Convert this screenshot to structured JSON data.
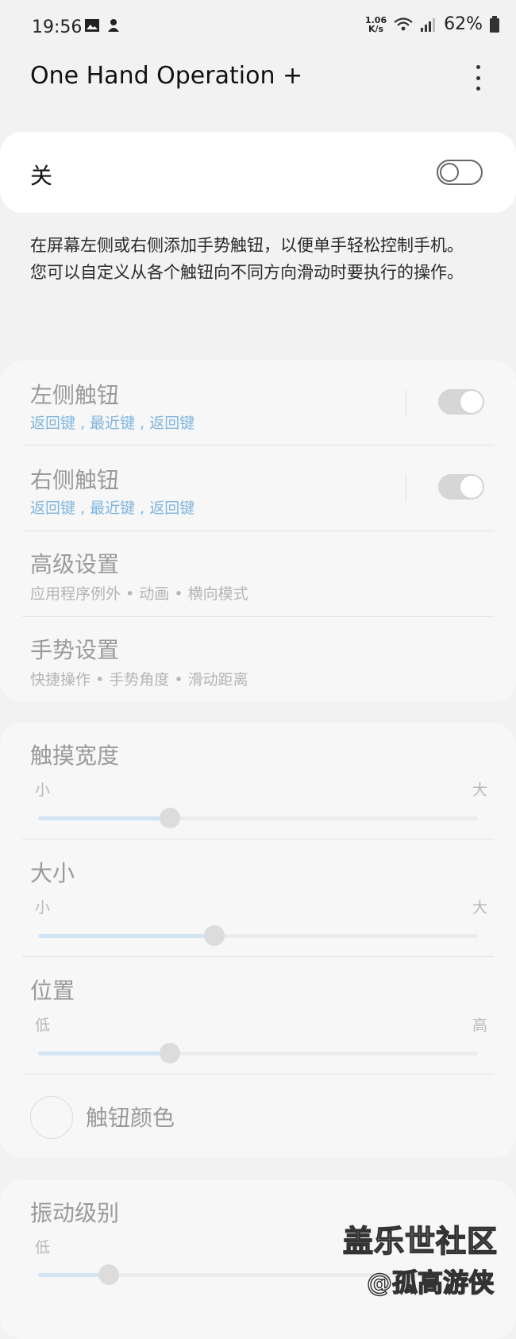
{
  "status_bar": {
    "time": "19:56",
    "speed_top": "1.06",
    "speed_bottom": "K/s",
    "battery": "62%"
  },
  "app_bar": {
    "title": "One Hand Operation +"
  },
  "master_switch": {
    "label": "关",
    "state": "off"
  },
  "description": {
    "line1": "在屏幕左侧或右侧添加手势触钮，以便单手轻松控制手机。",
    "line2": "您可以自定义从各个触钮向不同方向滑动时要执行的操作。"
  },
  "handles": {
    "left": {
      "title": "左侧触钮",
      "subtitle": "返回键 , 最近键 , 返回键",
      "state": "on"
    },
    "right": {
      "title": "右侧触钮",
      "subtitle": "返回键 , 最近键 , 返回键",
      "state": "on"
    },
    "advanced": {
      "title": "高级设置",
      "subtitle": "应用程序例外 • 动画 • 横向模式"
    },
    "gesture": {
      "title": "手势设置",
      "subtitle": "快捷操作 • 手势角度 • 滑动距离"
    }
  },
  "sliders": {
    "touch_width": {
      "title": "触摸宽度",
      "min": "小",
      "max": "大",
      "value": 0.3
    },
    "size": {
      "title": "大小",
      "min": "小",
      "max": "大",
      "value": 0.4
    },
    "position": {
      "title": "位置",
      "min": "低",
      "max": "高",
      "value": 0.3
    },
    "vibration": {
      "title": "振动级别",
      "min": "低",
      "value": 0.16
    }
  },
  "handle_color": {
    "label": "触钮颜色"
  },
  "watermark": {
    "line1": "盖乐世社区",
    "line2": "@孤高游侠"
  },
  "colors": {
    "accent_blue": "#7fb6e0",
    "disabled_text": "#9a9a9a"
  }
}
